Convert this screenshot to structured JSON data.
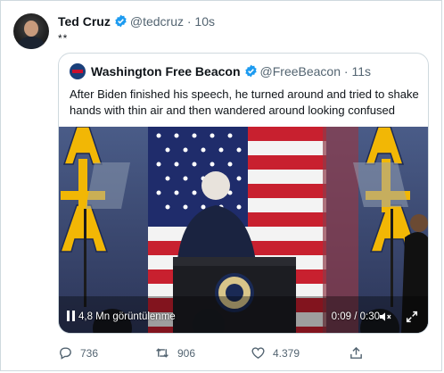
{
  "tweet": {
    "author_name": "Ted Cruz",
    "author_handle": "@tedcruz",
    "time": "· 10s",
    "body": "**"
  },
  "quoted": {
    "author_name": "Washington Free Beacon",
    "author_handle": "@FreeBeacon",
    "time": "· 11s",
    "body": "After Biden finished his speech, he turned around and tried to shake hands with thin air and then wandered around looking confused",
    "video": {
      "views": "4,8 Mn görüntülenme",
      "timestamp": "0:09 / 0:30"
    }
  },
  "actions": {
    "replies": "736",
    "retweets": "906",
    "likes": "4.379"
  },
  "colors": {
    "verified": "#1d9bf0",
    "text": "#0f1419",
    "secondary": "#536471",
    "border": "#cfd9de"
  },
  "icons": [
    "verified-badge-icon",
    "play-icon",
    "mute-icon",
    "fullscreen-icon",
    "reply-icon",
    "retweet-icon",
    "like-icon",
    "share-icon"
  ]
}
